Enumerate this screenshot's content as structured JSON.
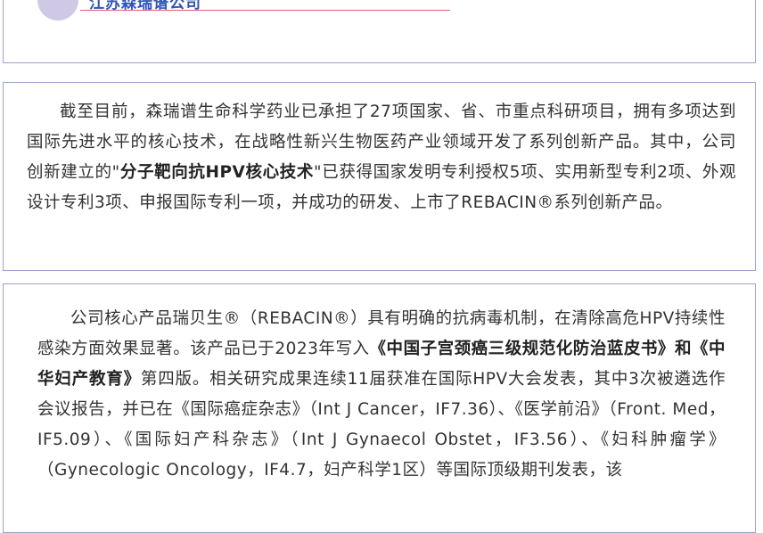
{
  "header": {
    "company": "江苏森瑞谱公司"
  },
  "paragraph1": {
    "s1": "截至目前，森瑞谱生命科学药业已承担了27项国家、省、市重点科研项目，拥有多项达到国际先进水平的核心技术，在战略性新兴生物医药产业领域开发了系列创新产品。其中，公司创新建立的\"",
    "b1": "分子靶向抗HPV核心技术",
    "s2": "\"已获得国家发明专利授权5项、实用新型专利2项、外观设计专利3项、申报国际专利一项，并成功的研发、上市了REBACIN®系列创新产品。"
  },
  "paragraph2": {
    "s1": "公司核心产品瑞贝生®（REBACIN®）具有明确的抗病毒机制，在清除高危HPV持续性感染方面效果显著。该产品已于2023年写入",
    "b1": "《中国子宫颈癌三级规范化防治蓝皮书》和《中华妇产教育》",
    "s2": "第四版。相关研究成果连续11届获准在国际HPV大会发表，其中3次被遴选作会议报告，并已在《国际癌症杂志》（Int J Cancer，IF7.36）、《医学前沿》（Front. Med，IF5.09）、《国际妇产科杂志》（Int J Gynaecol Obstet，IF3.56）、《妇科肿瘤学》（Gynecologic Oncology，IF4.7，妇产科学1区）等国际顶级期刊发表，该"
  },
  "colors": {
    "accent_blue": "#2e54b8",
    "accent_pink": "#e45a7a",
    "border": "#9aa4c8",
    "circle": "#cfc9e6"
  }
}
